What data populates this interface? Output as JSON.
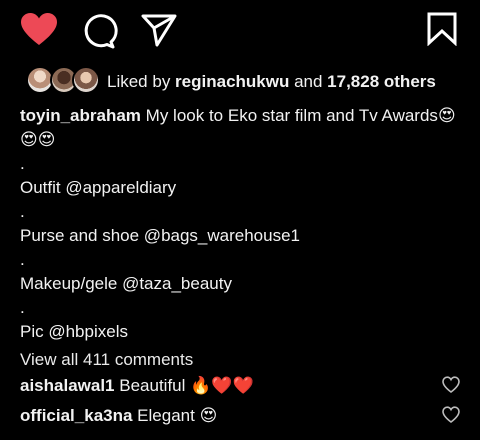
{
  "actions": {
    "like_icon": "heart-filled-icon",
    "comment_icon": "comment-bubble-icon",
    "share_icon": "paper-plane-icon",
    "save_icon": "bookmark-icon",
    "like_color": "#ed4956"
  },
  "likes": {
    "prefix": "Liked by ",
    "user": "reginachukwu",
    "middle": " and ",
    "count": "17,828 others"
  },
  "caption": {
    "username": "toyin_abraham",
    "line1_text": " My look to Eko star film and Tv Awards",
    "line1_emoji": "😍",
    "line2_emoji": "😍😍",
    "dot": ".",
    "outfit": "Outfit @appareldiary",
    "purse": "Purse and shoe @bags_warehouse1",
    "makeup": "Makeup/gele @taza_beauty",
    "pic": "Pic @hbpixels"
  },
  "view_all": "View all 411 comments",
  "comments": [
    {
      "username": "aishalawal1",
      "text": " Beautiful ",
      "emoji": "🔥❤️❤️"
    },
    {
      "username": "official_ka3na",
      "text": " Elegant ",
      "emoji": "😍"
    }
  ]
}
